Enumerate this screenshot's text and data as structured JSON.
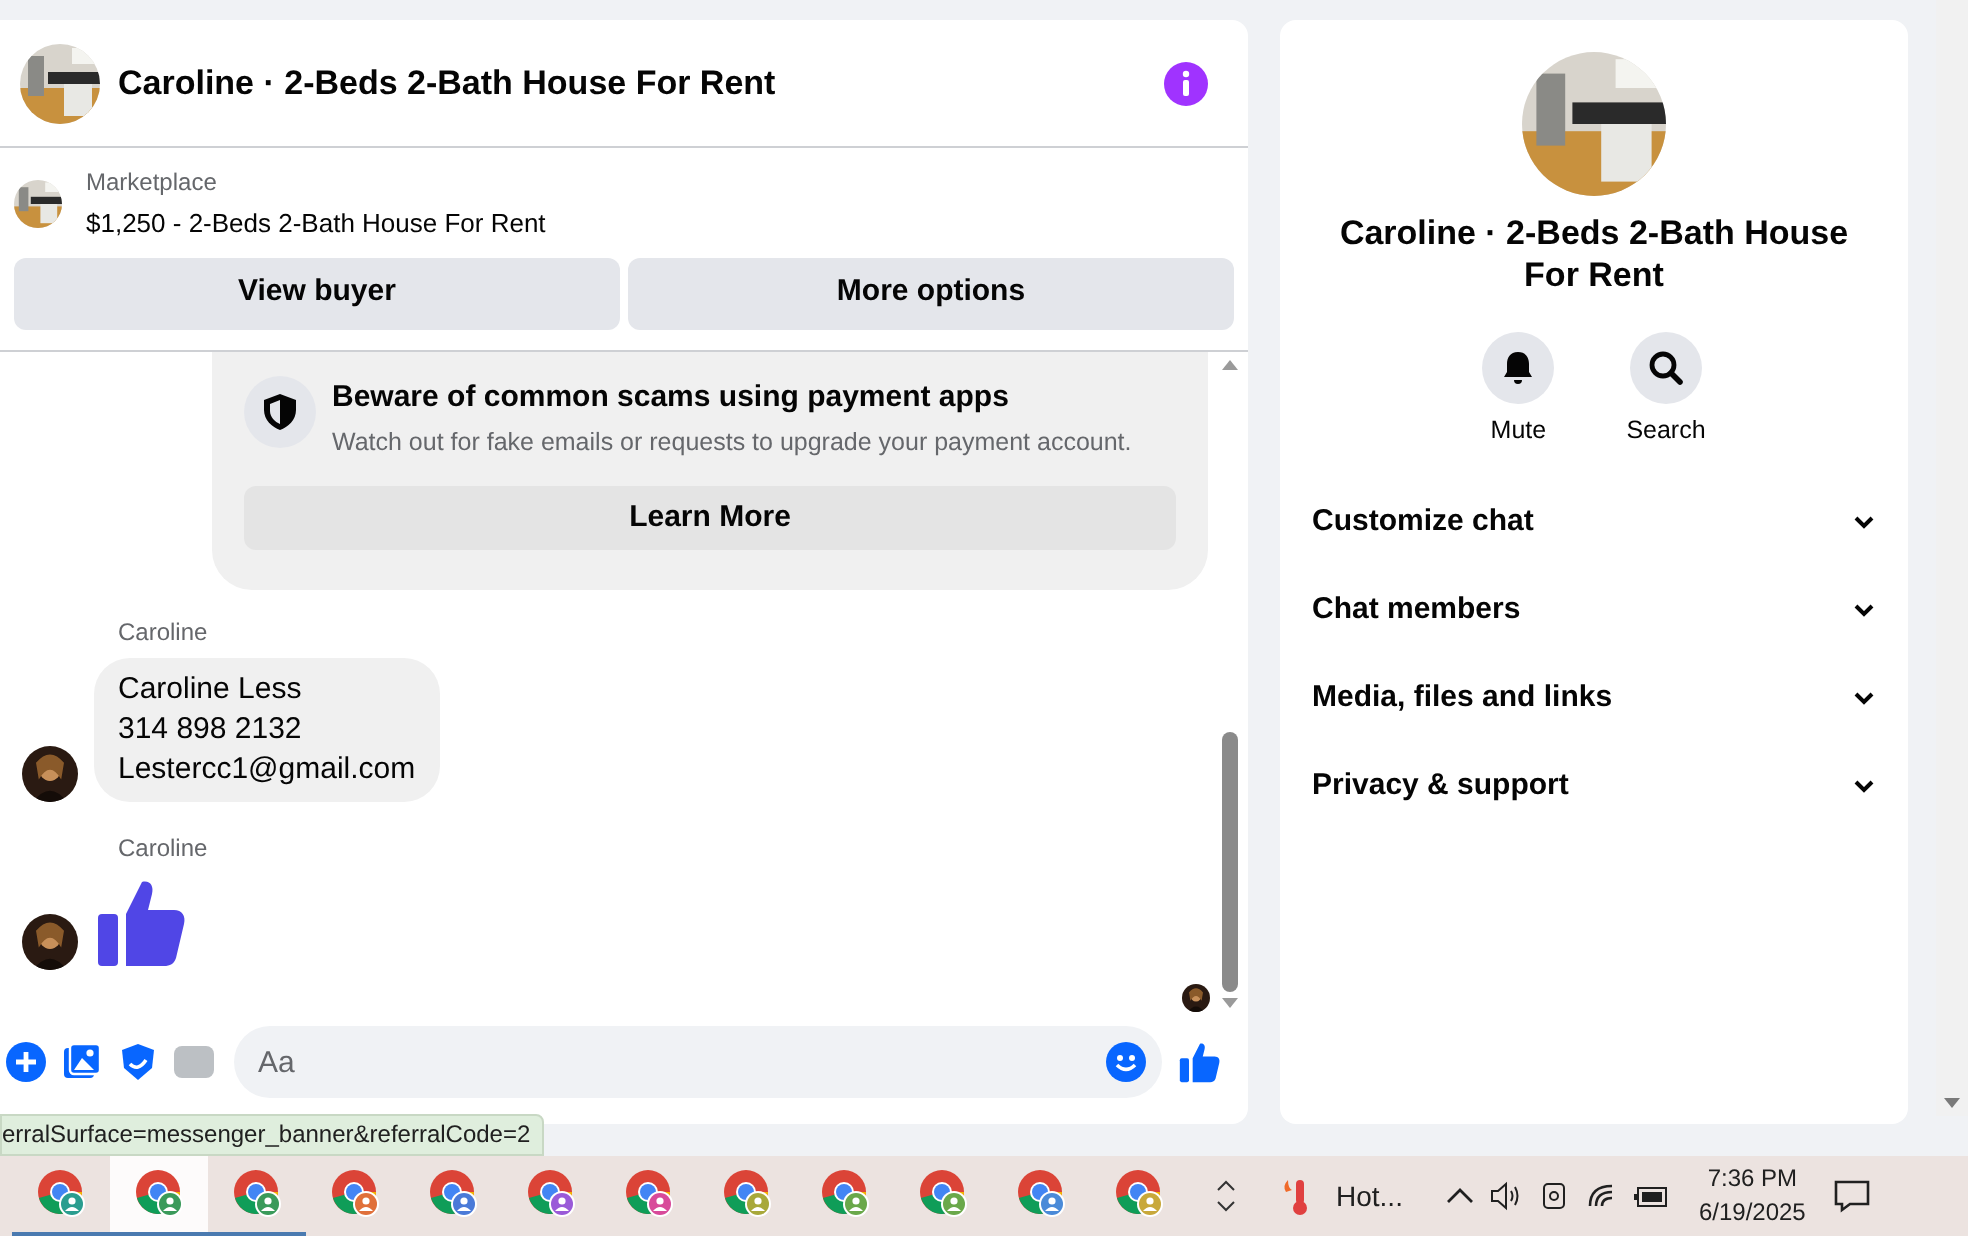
{
  "chat": {
    "title": "Caroline · 2-Beds 2-Bath House For Rent",
    "listing": {
      "source": "Marketplace",
      "title": "$1,250 - 2-Beds 2-Bath House For Rent"
    },
    "actions": [
      "View buyer",
      "More options"
    ],
    "notice": {
      "title": "Beware of common scams using payment apps",
      "body": "Watch out for fake emails or requests to upgrade your payment account.",
      "button": "Learn More"
    },
    "messages": [
      {
        "kind": "text",
        "sender": "Caroline",
        "lines": [
          "Caroline Less",
          "314 898 2132",
          "Lestercc1@gmail.com"
        ]
      },
      {
        "kind": "like",
        "sender": "Caroline"
      }
    ],
    "composer": {
      "placeholder": "Aa"
    }
  },
  "details": {
    "title": "Caroline · 2-Beds 2-Bath House For Rent",
    "actions": [
      {
        "kind": "mute",
        "label": "Mute"
      },
      {
        "kind": "search",
        "label": "Search"
      }
    ],
    "sections": [
      {
        "label": "Customize chat",
        "expanded": false
      },
      {
        "label": "Chat members",
        "expanded": false
      },
      {
        "label": "Media, files and links",
        "expanded": false
      },
      {
        "label": "Privacy & support",
        "expanded": false
      }
    ]
  },
  "status_url": "erralSurface=messenger_banner&referralCode=2",
  "taskbar": {
    "apps": [
      {
        "color": "#2a9d8f",
        "selected": false,
        "running": true
      },
      {
        "color": "#3a9a5a",
        "selected": true,
        "running": true
      },
      {
        "color": "#3a9a5a",
        "selected": false,
        "running": true
      },
      {
        "color": "#e0703a",
        "selected": false,
        "running": false
      },
      {
        "color": "#4a7ad8",
        "selected": false,
        "running": false
      },
      {
        "color": "#9a5ad8",
        "selected": false,
        "running": false
      },
      {
        "color": "#d84a9a",
        "selected": false,
        "running": false
      },
      {
        "color": "#a8a83a",
        "selected": false,
        "running": false
      },
      {
        "color": "#6aa84a",
        "selected": false,
        "running": false
      },
      {
        "color": "#6aa84a",
        "selected": false,
        "running": false
      },
      {
        "color": "#4a8ad8",
        "selected": false,
        "running": false
      },
      {
        "color": "#c8a83a",
        "selected": false,
        "running": false
      }
    ],
    "weather": "Hot...",
    "time": "7:36 PM",
    "date": "6/19/2025"
  }
}
